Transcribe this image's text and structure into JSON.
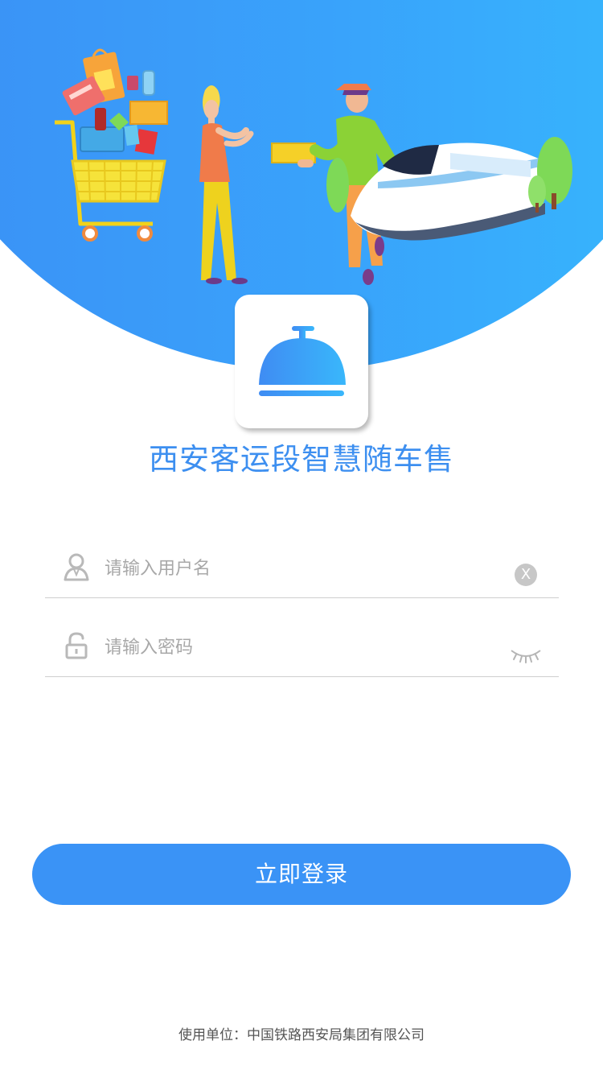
{
  "app": {
    "title": "西安客运段智慧随车售",
    "logo_icon": "service-bell-icon"
  },
  "login_form": {
    "username": {
      "value": "",
      "placeholder": "请输入用户名",
      "icon": "user-icon",
      "clear_icon": "clear-icon",
      "clear_glyph": "X"
    },
    "password": {
      "value": "",
      "placeholder": "请输入密码",
      "icon": "lock-icon",
      "toggle_icon": "eye-closed-icon"
    },
    "submit_label": "立即登录"
  },
  "footer": {
    "text": "使用单位：中国铁路西安局集团有限公司"
  },
  "colors": {
    "primary": "#3a93f6",
    "title": "#3d8ff0",
    "hero_gradient_start": "#3b8ff5",
    "hero_gradient_end": "#36b9fd"
  }
}
